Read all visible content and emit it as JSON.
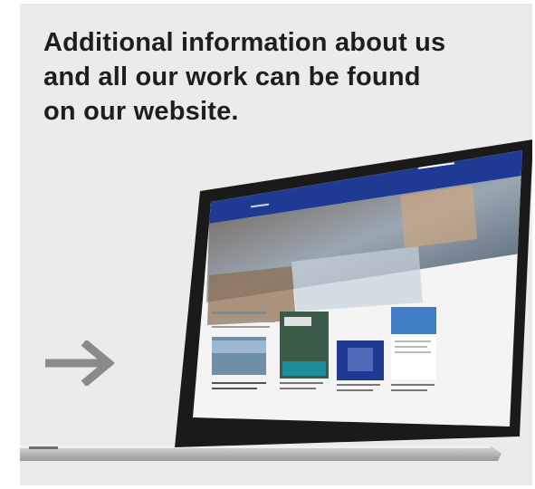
{
  "headline": {
    "line1": "Additional information about us",
    "line2": "and all our work can be found",
    "line3": "on our website."
  },
  "icons": {
    "arrow": "right-arrow-icon",
    "device": "laptop-icon"
  },
  "colors": {
    "background": "#ebebeb",
    "text": "#1e1e1e",
    "arrow": "#8a8a8a",
    "site_header": "#1f3a93",
    "bezel": "#1a1a1a"
  }
}
